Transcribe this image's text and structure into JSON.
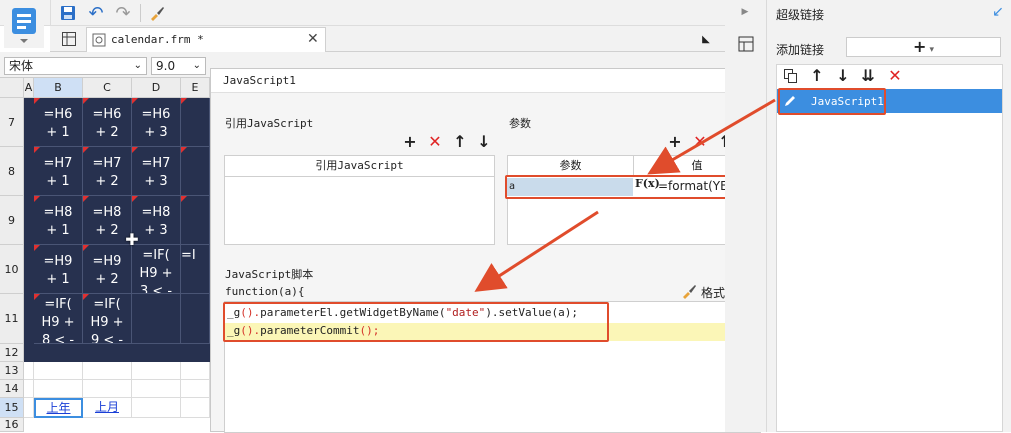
{
  "tab": {
    "filename": "calendar.frm *"
  },
  "format": {
    "font": "宋体",
    "size": "9.0"
  },
  "sheet": {
    "columns": [
      "A",
      "B",
      "C",
      "D",
      "E"
    ],
    "rows": [
      "7",
      "8",
      "9",
      "10",
      "11",
      "12",
      "13",
      "14",
      "15",
      "16"
    ],
    "cells": [
      [
        "=H6\n+ 1",
        "=H6\n+ 2",
        "=H6\n+ 3"
      ],
      [
        "=H7\n+ 1",
        "=H7\n+ 2",
        "=H7\n+ 3"
      ],
      [
        "=H8\n+ 1",
        "=H8\n+ 2",
        "=H8\n+ 3"
      ],
      [
        "=H9\n+ 1",
        "=H9\n+ 2",
        "=IF(\nH9 +\n3 < -"
      ],
      [
        "=IF(\nH9 +\n8 < -",
        "=IF(\nH9 +\n9 < -",
        ""
      ]
    ],
    "e_partial": [
      "=I",
      "=I"
    ],
    "links": [
      "上年",
      "上月"
    ]
  },
  "dialog": {
    "title": "JavaScript1",
    "ref_group": "引用JavaScript",
    "ref_table_header": "引用JavaScript",
    "param_group": "参数",
    "param_headers": [
      "参数",
      "值"
    ],
    "param_row": {
      "name": "a",
      "fx": "F(x)",
      "value": "=format(YEARDE"
    },
    "script_group": "JavaScript脚本",
    "func_sig": "function(a){",
    "format_code": "格式化代码",
    "code": {
      "line1_a": "_g",
      "line1_b": "().",
      "line1_c": "parameterEl.getWidgetByName(",
      "line1_str": "\"date\"",
      "line1_d": ").setValue(a);",
      "line2_a": "_g",
      "line2_b": "().",
      "line2_c": "parameterCommit",
      "line2_d": "();"
    }
  },
  "right_panel": {
    "title": "超级链接",
    "add_label": "添加链接",
    "add_btn": "+",
    "item": "JavaScript1"
  },
  "colors": {
    "accent": "#3c8ee0",
    "cell_bg": "#27314f",
    "highlight": "#e04c2c"
  }
}
